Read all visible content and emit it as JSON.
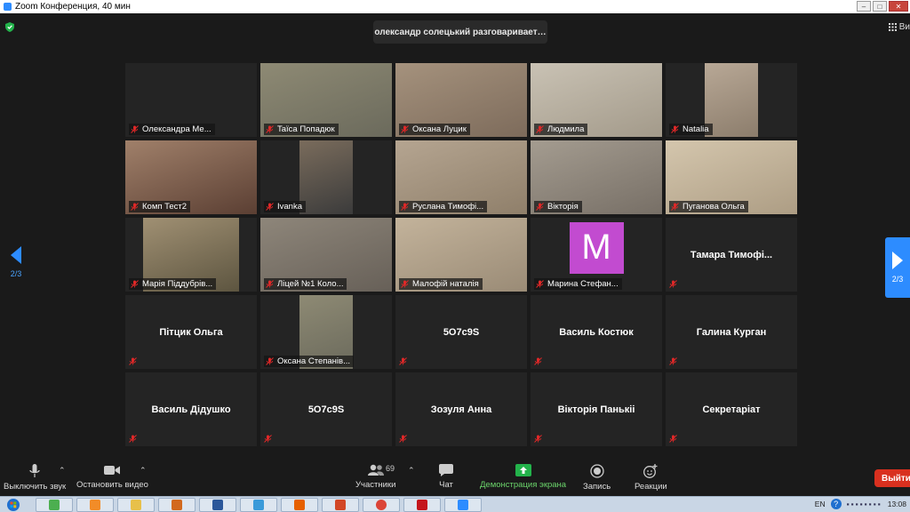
{
  "window": {
    "title": "Zoom Конференция, 40 мин"
  },
  "speaking": {
    "text": "олександр солецький разговаривает…"
  },
  "view_button": {
    "label": "Ви"
  },
  "pagination": {
    "left": "2/3",
    "right": "2/3"
  },
  "tiles": [
    {
      "name": "Олександра Ме...",
      "type": "blank"
    },
    {
      "name": "Taïca Попадюк",
      "type": "video"
    },
    {
      "name": "Оксана Луцик",
      "type": "video"
    },
    {
      "name": "Людмила",
      "type": "video"
    },
    {
      "name": "Natalia",
      "type": "video"
    },
    {
      "name": "Комп Тест2",
      "type": "video"
    },
    {
      "name": "Ivanka",
      "type": "video"
    },
    {
      "name": "Руслана Тимофі...",
      "type": "video"
    },
    {
      "name": "Вікторія",
      "type": "video"
    },
    {
      "name": "Пуганова Ольга",
      "type": "video"
    },
    {
      "name": "Марія Піддубрів...",
      "type": "video"
    },
    {
      "name": "Ліцей №1 Коло...",
      "type": "video"
    },
    {
      "name": "Малофій наталія",
      "type": "video"
    },
    {
      "name": "Марина Стефан...",
      "type": "avatar",
      "avatar_letter": "M"
    },
    {
      "name": "Тамара Тимофі...",
      "type": "name"
    },
    {
      "name": "Пітцик Ольга",
      "type": "name"
    },
    {
      "name": "Оксана Степанів...",
      "type": "photo"
    },
    {
      "name": "5O7c9S",
      "type": "name"
    },
    {
      "name": "Василь Костюк",
      "type": "name"
    },
    {
      "name": "Галина Курган",
      "type": "name"
    },
    {
      "name": "Василь Дідушко",
      "type": "name"
    },
    {
      "name": "5O7c9S",
      "type": "name"
    },
    {
      "name": "Зозуля Анна",
      "type": "name"
    },
    {
      "name": "Вікторія Панькіі",
      "type": "name"
    },
    {
      "name": "Секретаріат",
      "type": "name"
    }
  ],
  "toolbar": {
    "mute": "Выключить звук",
    "video": "Остановить видео",
    "participants": "Участники",
    "participants_count": "69",
    "chat": "Чат",
    "share": "Демонстрация экрана",
    "record": "Запись",
    "reactions": "Реакции",
    "exit": "Выйти"
  },
  "taskbar": {
    "lang": "EN",
    "time": "13:08"
  },
  "colors": {
    "accent": "#2d8cff",
    "share_green": "#23b34b",
    "exit_red": "#d9301f",
    "mute_red": "#e02828",
    "avatar_purple": "#c24bd0"
  }
}
